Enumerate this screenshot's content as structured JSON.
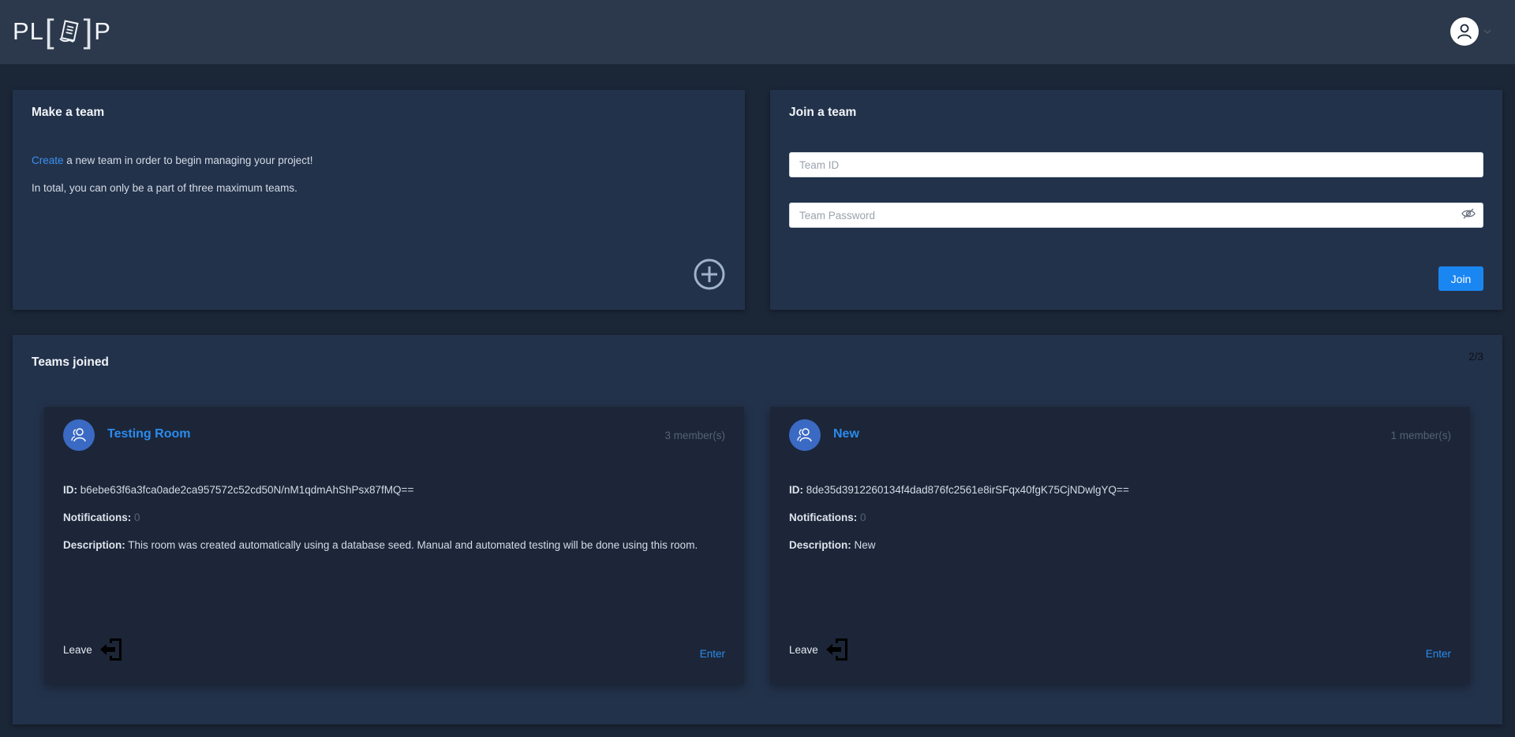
{
  "header": {
    "logo": {
      "left": "PL",
      "right": "P"
    }
  },
  "make_team": {
    "title": "Make a team",
    "create_link": "Create",
    "line1_rest": " a new team in order to begin managing your project!",
    "line2": "In total, you can only be a part of three maximum teams."
  },
  "join_team": {
    "title": "Join a team",
    "team_id_placeholder": "Team ID",
    "team_password_placeholder": "Team Password",
    "join_label": "Join"
  },
  "teams_joined": {
    "title": "Teams joined",
    "counter": "2/3",
    "teams": [
      {
        "name": "Testing Room",
        "members": "3 member(s)",
        "id_label": "ID:",
        "id": "b6ebe63f6a3fca0ade2ca957572c52cd50N/nM1qdmAhShPsx87fMQ==",
        "notifications_label": "Notifications:",
        "notifications": "0",
        "description_label": "Description:",
        "description": "This room was created automatically using a database seed. Manual and automated testing will be done using this room.",
        "leave_label": "Leave",
        "enter_label": "Enter"
      },
      {
        "name": "New",
        "members": "1 member(s)",
        "id_label": "ID:",
        "id": "8de35d3912260134f4dad876fc2561e8irSFqx40fgK75CjNDwlgYQ==",
        "notifications_label": "Notifications:",
        "notifications": "0",
        "description_label": "Description:",
        "description": "New",
        "leave_label": "Leave",
        "enter_label": "Enter"
      }
    ]
  },
  "colors": {
    "background": "#1b2637",
    "header": "#2c394c",
    "card": "#23324b",
    "team_card": "#1c2638",
    "accent": "#1a86f2",
    "link": "#2b8bee",
    "team_icon": "#3b6ac4"
  },
  "icons": {
    "logo": "document-icon",
    "avatar": "user-icon",
    "add": "plus-circle-icon",
    "password": "eye-slash-icon",
    "team": "users-icon",
    "leave": "exit-icon"
  }
}
